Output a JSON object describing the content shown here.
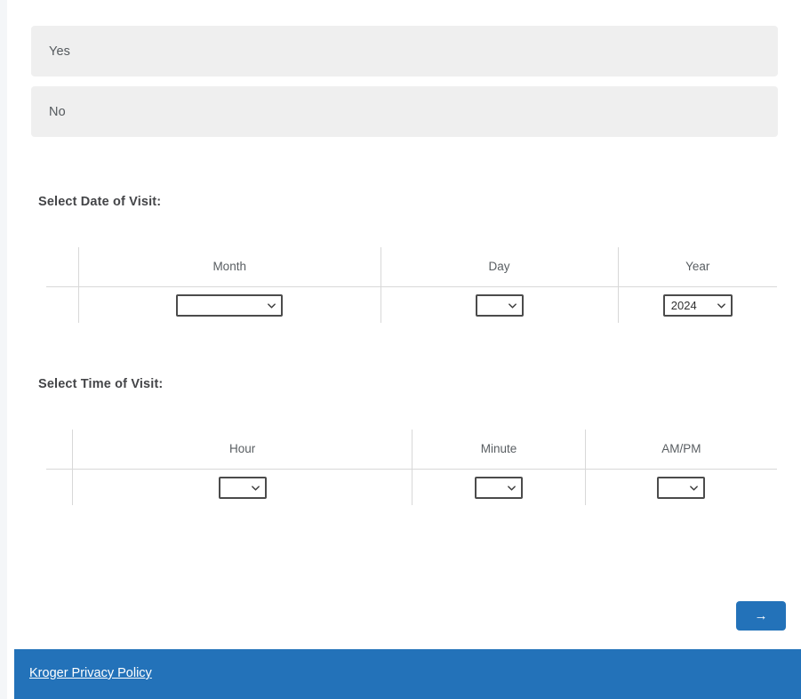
{
  "choices": {
    "items": [
      {
        "label": "Yes"
      },
      {
        "label": "No"
      }
    ]
  },
  "date_section": {
    "heading": "Select Date of Visit:",
    "columns": [
      {
        "title": "Month",
        "value": "",
        "icon": "chevron-down-icon"
      },
      {
        "title": "Day",
        "value": "",
        "icon": "chevron-down-icon"
      },
      {
        "title": "Year",
        "value": "2024",
        "icon": "chevron-down-icon"
      }
    ]
  },
  "time_section": {
    "heading": "Select Time of Visit:",
    "columns": [
      {
        "title": "Hour",
        "value": "",
        "icon": "chevron-down-icon"
      },
      {
        "title": "Minute",
        "value": "",
        "icon": "chevron-down-icon"
      },
      {
        "title": "AM/PM",
        "value": "",
        "icon": "chevron-down-icon"
      }
    ]
  },
  "next_button": {
    "label": "→",
    "icon": "arrow-right-icon",
    "color": "#2372b9"
  },
  "footer": {
    "privacy_link": "Kroger Privacy Policy",
    "color": "#2372b9"
  }
}
